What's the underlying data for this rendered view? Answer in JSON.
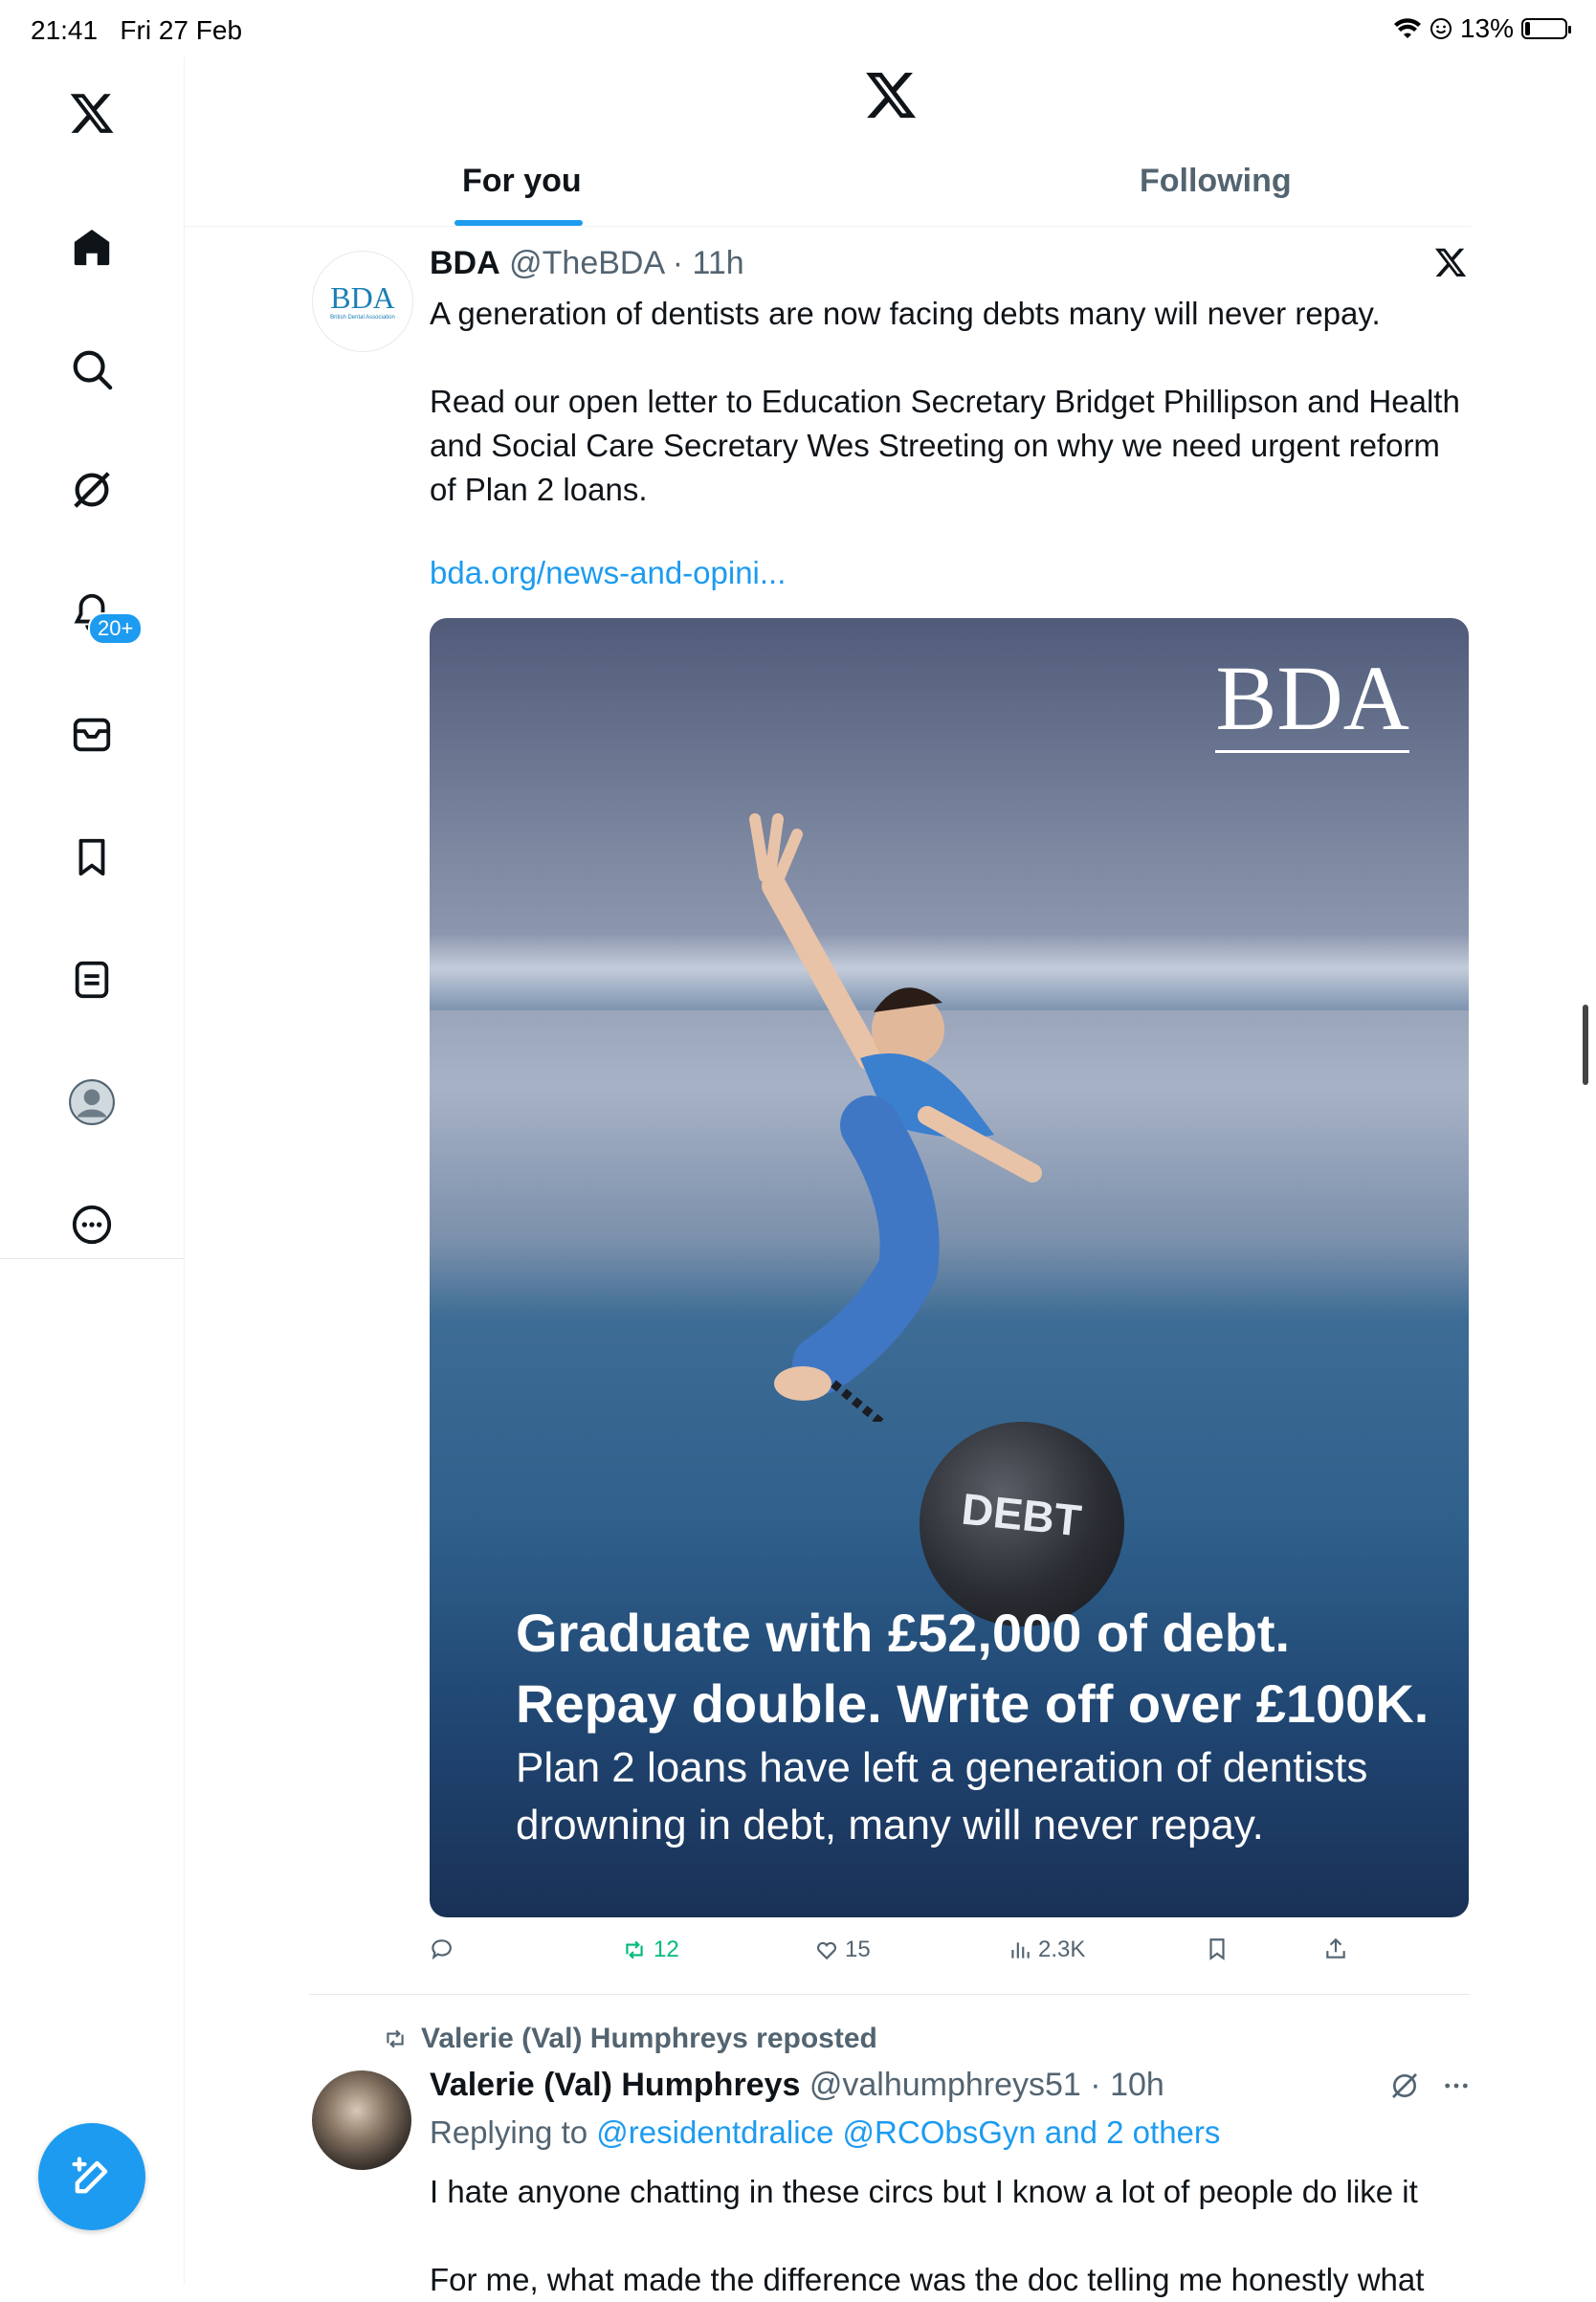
{
  "status_bar": {
    "time": "21:41",
    "date": "Fri 27 Feb",
    "battery": "13%",
    "battery_level": 0.13
  },
  "sidebar": {
    "notifications_badge": "20+"
  },
  "tabs": [
    {
      "label": "For you"
    },
    {
      "label": "Following"
    }
  ],
  "post1": {
    "name": "BDA",
    "handle": "@TheBDA",
    "age": "11h",
    "avatar_text": "BDA",
    "avatar_subtext": "British Dental Association",
    "text_p1": "A generation of dentists are now facing debts many will never repay.",
    "text_p2": "Read our open letter to Education Secretary Bridget Phillipson and Health and Social Care Secretary Wes Streeting on why we need urgent reform of Plan 2 loans.",
    "link": "bda.org/news-and-opini...",
    "media": {
      "logo": "BDA",
      "ball_label": "DEBT",
      "headline_1": "Graduate with £52,000 of debt.",
      "headline_2": "Repay double. Write off over £100K.",
      "subline_1": "Plan 2 loans have left a generation of dentists",
      "subline_2": "drowning in debt, many will never repay."
    },
    "stats": {
      "reposts": "12",
      "likes": "15",
      "views": "2.3K"
    }
  },
  "post2": {
    "repost_label": "Valerie (Val) Humphreys reposted",
    "name": "Valerie (Val) Humphreys",
    "handle": "@valhumphreys51",
    "age": "10h",
    "replying_prefix": "Replying to",
    "replying_mentions": "@residentdralice @RCObsGyn and 2 others",
    "text_p1": "I hate anyone chatting in these circs but I know a lot of people do like it",
    "text_p2": "For me, what made the difference was the doc telling me honestly what"
  },
  "colors": {
    "accent": "#1d9bf0",
    "repost_green": "#00ba7c",
    "muted": "#536471"
  }
}
